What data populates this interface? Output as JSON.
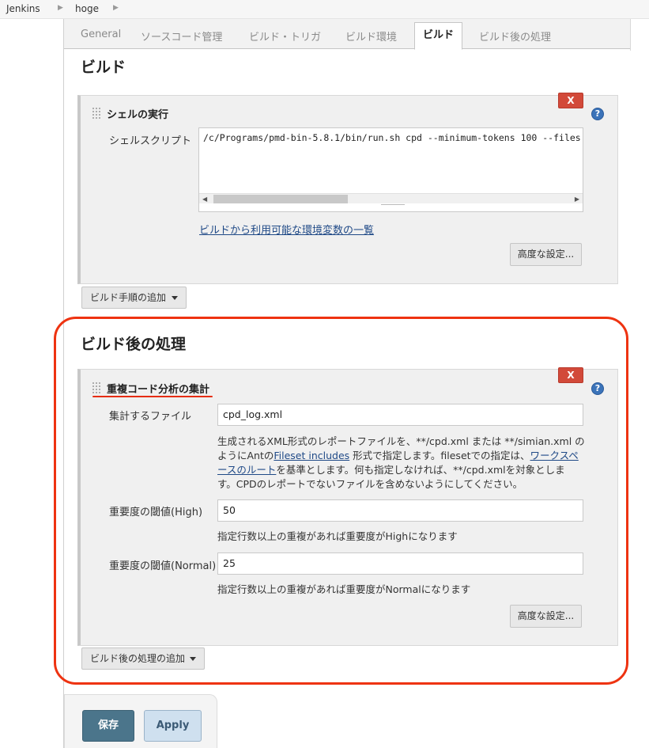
{
  "breadcrumb": [
    {
      "label": "Jenkins"
    },
    {
      "label": "hoge"
    }
  ],
  "tabs": [
    {
      "label": "General"
    },
    {
      "label": "ソースコード管理"
    },
    {
      "label": "ビルド・トリガ"
    },
    {
      "label": "ビルド環境"
    },
    {
      "label": "ビルド"
    },
    {
      "label": "ビルド後の処理"
    }
  ],
  "build": {
    "title": "ビルド",
    "shell_step": {
      "title": "シェルの実行",
      "delete_label": "X",
      "help": "?",
      "script_label": "シェルスクリプト",
      "script_value": "/c/Programs/pmd-bin-5.8.1/bin/run.sh cpd --minimum-tokens 100 --files",
      "env_link": "ビルドから利用可能な環境変数の一覧",
      "advanced_label": "高度な設定..."
    },
    "add_step_label": "ビルド手順の追加"
  },
  "post_build": {
    "title": "ビルド後の処理",
    "dry_step": {
      "title": "重複コード分析の集計",
      "delete_label": "X",
      "help": "?",
      "file_label": "集計するファイル",
      "file_value": "cpd_log.xml",
      "file_desc": {
        "part1": "生成されるXML形式のレポートファイルを、**/cpd.xml または **/simian.xml の",
        "part2": "ようにAntの",
        "link1": "Fileset includes",
        "part3": " 形式で指定します。filesetでの指定は、",
        "link2a": "ワークスペ",
        "link2b": "ースのルート",
        "part4": "を基準とします。何も指定しなければ、**/cpd.xmlを対象としま",
        "part5": "す。CPDのレポートでないファイルを含めないようにしてください。"
      },
      "high_label": "重要度の閾値(High)",
      "high_value": "50",
      "high_desc": "指定行数以上の重複があれば重要度がHighになります",
      "normal_label": "重要度の閾値(Normal)",
      "normal_value": "25",
      "normal_desc": "指定行数以上の重複があれば重要度がNormalになります",
      "advanced_label": "高度な設定..."
    },
    "add_step_label": "ビルド後の処理の追加"
  },
  "footer": {
    "save_label": "保存",
    "apply_label": "Apply"
  },
  "colors": {
    "annotation": "#ee3311",
    "save_button": "#4b758b",
    "delete_button": "#d24939",
    "link": "#204a87"
  }
}
